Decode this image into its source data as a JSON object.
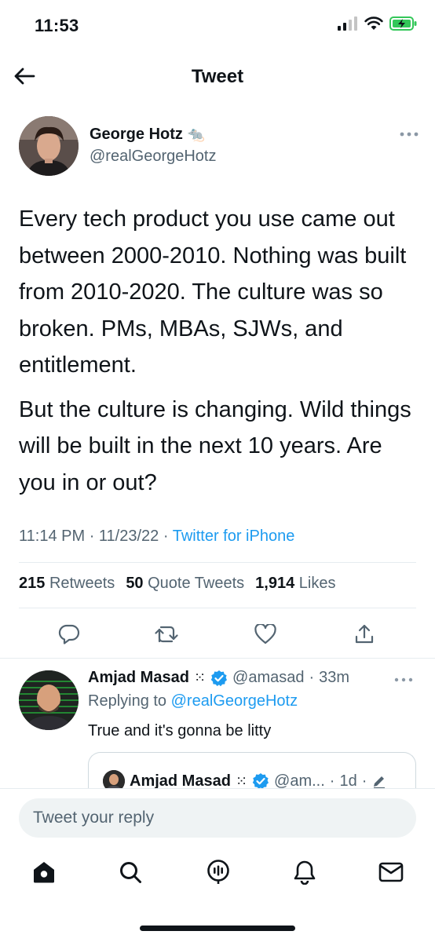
{
  "status_bar": {
    "time": "11:53"
  },
  "header": {
    "title": "Tweet"
  },
  "author": {
    "name": "George Hotz",
    "emoji": "🐀",
    "handle": "@realGeorgeHotz"
  },
  "tweet": {
    "paragraphs": [
      "Every tech product you use came out between 2000-2010. Nothing was built from 2010-2020. The culture was so broken. PMs, MBAs, SJWs, and entitlement.",
      "But the culture is changing. Wild things will be built in the next 10 years. Are you in or out?"
    ],
    "time": "11:14 PM",
    "date": "11/23/22",
    "source": "Twitter for iPhone"
  },
  "stats": {
    "retweets_count": "215",
    "retweets_label": "Retweets",
    "quotes_count": "50",
    "quotes_label": "Quote Tweets",
    "likes_count": "1,914",
    "likes_label": "Likes"
  },
  "reply": {
    "name": "Amjad Masad",
    "name_symbol": "⁙",
    "handle": "@amasad",
    "age": "33m",
    "replying_prefix": "Replying to",
    "replying_handle": "@realGeorgeHotz",
    "text": "True and it's gonna be litty"
  },
  "quote": {
    "name": "Amjad Masad",
    "name_symbol": "⁙",
    "handle": "@am...",
    "age": "1d"
  },
  "compose": {
    "placeholder": "Tweet your reply"
  },
  "colors": {
    "accent": "#1d9bf0",
    "muted": "#536471",
    "text": "#0f1419",
    "battery": "#34c759"
  }
}
